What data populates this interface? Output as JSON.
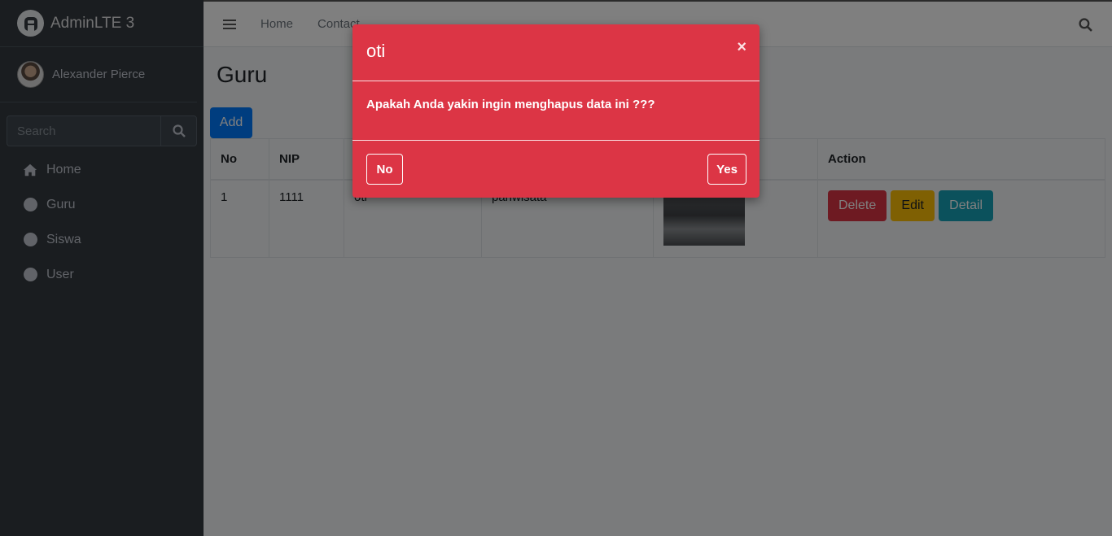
{
  "brand": {
    "name": "AdminLTE 3",
    "logo_icon": "adminlte-logo-icon"
  },
  "user": {
    "name": "Alexander Pierce"
  },
  "sidebar": {
    "search_placeholder": "Search",
    "items": [
      {
        "label": "Home",
        "icon": "home-icon"
      },
      {
        "label": "Guru",
        "icon": "circle-icon"
      },
      {
        "label": "Siswa",
        "icon": "circle-icon"
      },
      {
        "label": "User",
        "icon": "circle-icon"
      }
    ]
  },
  "topbar": {
    "links": [
      "Home",
      "Contact"
    ]
  },
  "page": {
    "title": "Guru",
    "add_label": "Add"
  },
  "table": {
    "headers": [
      "No",
      "NIP",
      "",
      "",
      "",
      "Action"
    ],
    "rows": [
      {
        "no": "1",
        "nip": "1111",
        "name": "oti",
        "mapel": "pariwisata"
      }
    ],
    "actions": {
      "delete": "Delete",
      "edit": "Edit",
      "detail": "Detail"
    }
  },
  "modal": {
    "title": "oti",
    "close": "×",
    "message": "Apakah Anda yakin ingin menghapus data ini ???",
    "no_label": "No",
    "yes_label": "Yes"
  },
  "colors": {
    "danger": "#dc3545",
    "primary": "#007bff",
    "warning": "#ffc107",
    "info": "#17a2b8",
    "sidebar": "#343a40"
  }
}
